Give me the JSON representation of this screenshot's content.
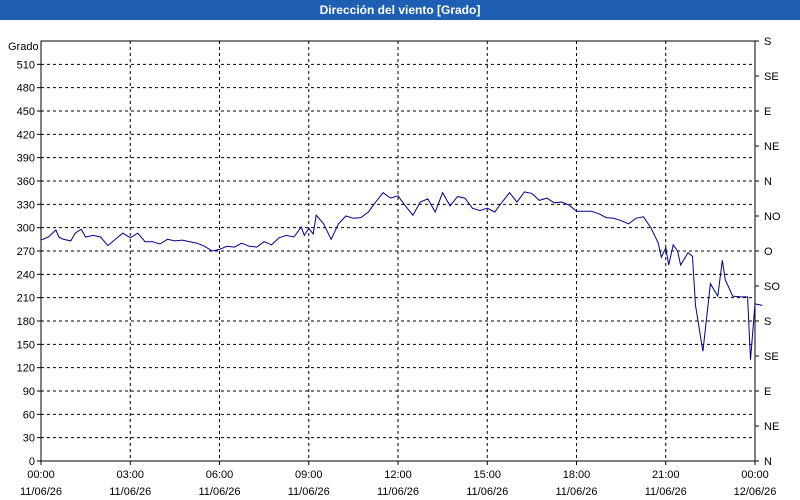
{
  "window": {
    "title": "Dirección del viento [Grado]"
  },
  "chart_data": {
    "type": "line",
    "title": "Dirección del viento [Grado]",
    "ylabel": "Grado",
    "ylim": [
      0,
      540
    ],
    "yticks": [
      0,
      30,
      60,
      90,
      120,
      150,
      180,
      210,
      240,
      270,
      300,
      330,
      360,
      390,
      420,
      450,
      480,
      510
    ],
    "right_ticks": [
      {
        "v": 0,
        "label": "N"
      },
      {
        "v": 45,
        "label": "NE"
      },
      {
        "v": 90,
        "label": "E"
      },
      {
        "v": 135,
        "label": "SE"
      },
      {
        "v": 180,
        "label": "S"
      },
      {
        "v": 225,
        "label": "SO"
      },
      {
        "v": 270,
        "label": "O"
      },
      {
        "v": 315,
        "label": "NO"
      },
      {
        "v": 360,
        "label": "N"
      },
      {
        "v": 405,
        "label": "NE"
      },
      {
        "v": 450,
        "label": "E"
      },
      {
        "v": 495,
        "label": "SE"
      },
      {
        "v": 540,
        "label": "S"
      }
    ],
    "xlim_hours": [
      0,
      24
    ],
    "xticks": [
      {
        "h": 0,
        "time": "00:00",
        "date": "11/06/26"
      },
      {
        "h": 3,
        "time": "03:00",
        "date": "11/06/26"
      },
      {
        "h": 6,
        "time": "06:00",
        "date": "11/06/26"
      },
      {
        "h": 9,
        "time": "09:00",
        "date": "11/06/26"
      },
      {
        "h": 12,
        "time": "12:00",
        "date": "11/06/26"
      },
      {
        "h": 15,
        "time": "15:00",
        "date": "11/06/26"
      },
      {
        "h": 18,
        "time": "18:00",
        "date": "11/06/26"
      },
      {
        "h": 21,
        "time": "21:00",
        "date": "11/06/26"
      },
      {
        "h": 24,
        "time": "00:00",
        "date": "12/06/26"
      }
    ],
    "grid": true,
    "line_color": "#00008b",
    "series": [
      {
        "x": [
          0,
          0.25,
          0.5,
          0.6,
          0.75,
          1,
          1.15,
          1.35,
          1.5,
          1.75,
          2,
          2.25,
          2.5,
          2.75,
          3,
          3.25,
          3.5,
          3.75,
          4,
          4.25,
          4.5,
          4.75,
          5,
          5.25,
          5.5,
          5.75,
          6,
          6.25,
          6.5,
          6.75,
          7,
          7.25,
          7.5,
          7.75,
          8,
          8.25,
          8.5,
          8.75,
          8.85,
          9,
          9.15,
          9.25,
          9.5,
          9.75,
          10,
          10.25,
          10.5,
          10.75,
          11,
          11.25,
          11.5,
          11.75,
          12,
          12.25,
          12.5,
          12.75,
          13,
          13.25,
          13.5,
          13.75,
          14,
          14.25,
          14.5,
          14.75,
          15,
          15.25,
          15.5,
          15.75,
          16,
          16.25,
          16.5,
          16.75,
          17,
          17.25,
          17.5,
          17.75,
          18,
          18.25,
          18.5,
          18.75,
          19,
          19.25,
          19.5,
          19.75,
          20,
          20.25,
          20.5,
          20.75,
          20.85,
          21,
          21.1,
          21.25,
          21.4,
          21.5,
          21.75,
          21.9,
          22,
          22.25,
          22.5,
          22.75,
          22.9,
          23,
          23.25,
          23.5,
          23.75,
          23.85,
          24,
          24.25
        ],
        "y": [
          284,
          288,
          297,
          288,
          285,
          283,
          293,
          298,
          288,
          290,
          288,
          277,
          285,
          293,
          287,
          293,
          282,
          282,
          279,
          285,
          283,
          284,
          282,
          280,
          276,
          270,
          272,
          276,
          275,
          280,
          276,
          275,
          282,
          278,
          287,
          290,
          288,
          301,
          290,
          299,
          292,
          316,
          305,
          285,
          305,
          315,
          312,
          313,
          320,
          333,
          345,
          338,
          341,
          328,
          316,
          333,
          337,
          320,
          345,
          328,
          340,
          338,
          325,
          322,
          325,
          320,
          333,
          345,
          333,
          346,
          344,
          335,
          338,
          332,
          333,
          329,
          321,
          321,
          321,
          318,
          313,
          312,
          309,
          305,
          312,
          314,
          300,
          280,
          262,
          274,
          252,
          278,
          270,
          252,
          268,
          263,
          200,
          141,
          228,
          212,
          258,
          233,
          212,
          211,
          211,
          130,
          202,
          200
        ]
      }
    ]
  }
}
